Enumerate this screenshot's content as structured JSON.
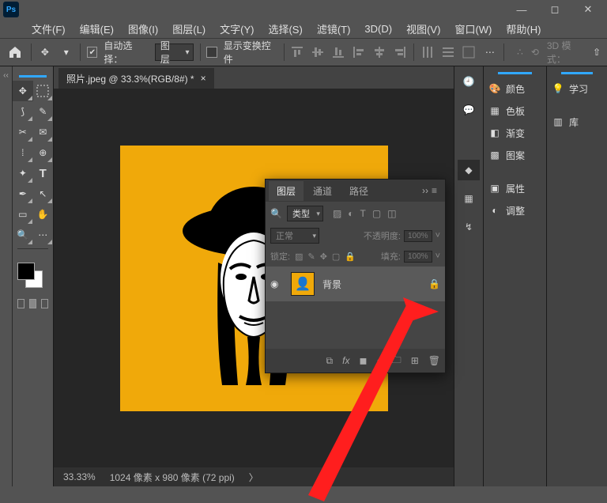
{
  "menubar": [
    "文件(F)",
    "编辑(E)",
    "图像(I)",
    "图层(L)",
    "文字(Y)",
    "选择(S)",
    "滤镜(T)",
    "3D(D)",
    "视图(V)",
    "窗口(W)",
    "帮助(H)"
  ],
  "optbar": {
    "auto_select_checked": true,
    "auto_select_label": "自动选择：",
    "auto_select_target": "图层",
    "show_transform_checked": false,
    "show_transform_label": "显示变换控件",
    "mode_3d_label": "3D 模式："
  },
  "document": {
    "tab_title": "照片.jpeg @ 33.3%(RGB/8#) *"
  },
  "statusbar": {
    "zoom": "33.33%",
    "doc_info": "1024 像素 x 980 像素 (72 ppi)"
  },
  "right_panel_labels": {
    "color": "颜色",
    "swatches": "色板",
    "gradient": "渐变",
    "patterns": "图案",
    "properties": "属性",
    "adjustments": "调整",
    "learn": "学习",
    "library": "库"
  },
  "layers_panel": {
    "tabs": [
      "图层",
      "通道",
      "路径"
    ],
    "filter_kind": "类型",
    "blend_mode": "正常",
    "opacity_label": "不透明度:",
    "opacity_value": "100%",
    "lock_label": "锁定:",
    "fill_label": "填充:",
    "fill_value": "100%",
    "layers": [
      {
        "name": "背景",
        "locked": true,
        "visible": true
      }
    ]
  }
}
